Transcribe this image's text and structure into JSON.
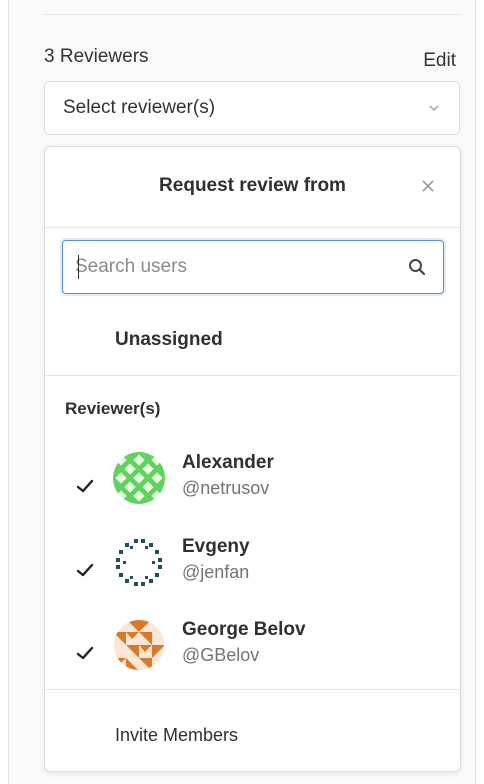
{
  "sidebar": {
    "reviewers_count_label": "3 Reviewers",
    "edit_label": "Edit",
    "select_placeholder": "Select reviewer(s)"
  },
  "dropdown": {
    "title": "Request review from",
    "search_placeholder": "Search users",
    "unassigned_label": "Unassigned",
    "section_label": "Reviewer(s)",
    "reviewers": [
      {
        "name": "Alexander",
        "username": "@netrusov",
        "selected": true,
        "avatar_color": "#5fd35f"
      },
      {
        "name": "Evgeny",
        "username": "@jenfan",
        "selected": true,
        "avatar_color": "#1f4f57"
      },
      {
        "name": "George Belov",
        "username": "@GBelov",
        "selected": true,
        "avatar_color": "#d9792a"
      }
    ],
    "footer_label": "Invite Members"
  },
  "icons": {
    "select": "chevron-down-icon",
    "close": "close-icon",
    "search": "search-icon",
    "check": "check-icon"
  },
  "colors": {
    "focus_border": "#5b8fd0",
    "muted_text": "#737373",
    "divider": "#e6e6e6"
  }
}
